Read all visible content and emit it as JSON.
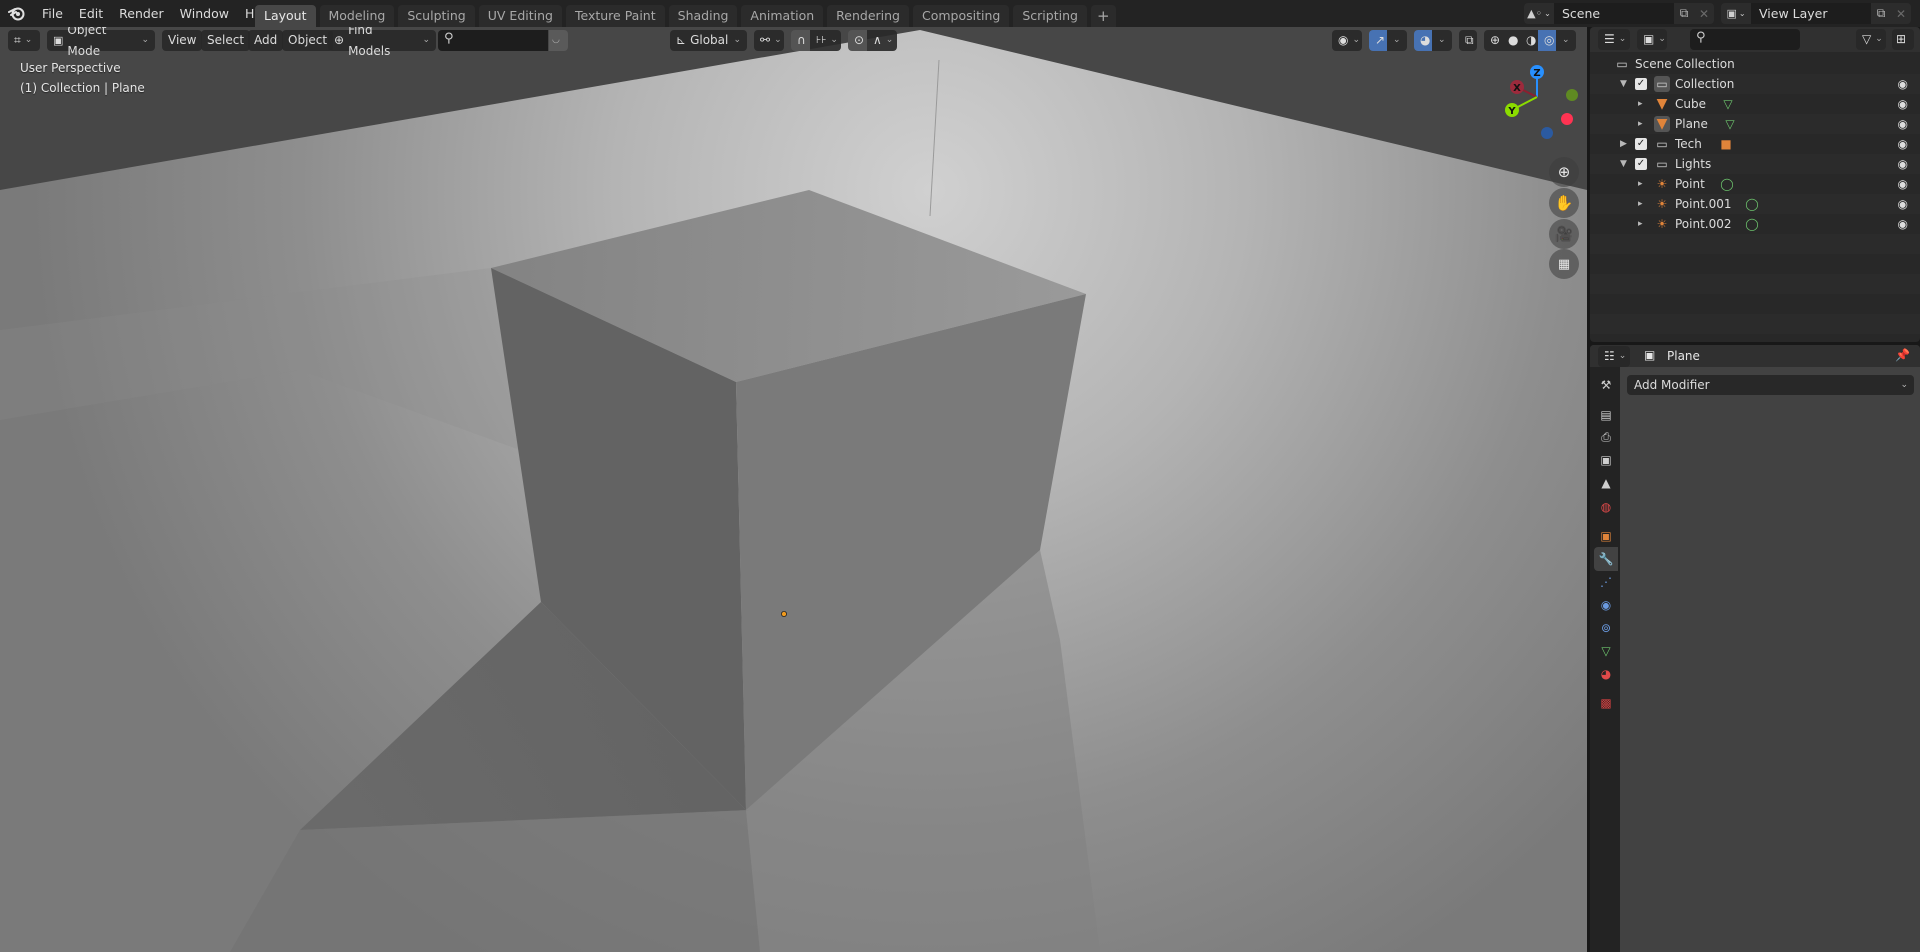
{
  "topbar": {
    "menus": [
      "File",
      "Edit",
      "Render",
      "Window",
      "Help"
    ],
    "workspaces": [
      "Layout",
      "Modeling",
      "Sculpting",
      "UV Editing",
      "Texture Paint",
      "Shading",
      "Animation",
      "Rendering",
      "Compositing",
      "Scripting"
    ],
    "active_workspace": "Layout",
    "add_workspace": "+",
    "scene": "Scene",
    "view_layer": "View Layer"
  },
  "viewport": {
    "header": {
      "mode": "Object Mode",
      "menus": [
        "View",
        "Select",
        "Add",
        "Object"
      ],
      "find_models": "Find Models",
      "search_placeholder": "",
      "transform_orientation": "Global"
    },
    "info": {
      "perspective": "User Perspective",
      "collection": "(1) Collection | Plane"
    },
    "gizmo": {
      "x": "X",
      "y": "Y",
      "z": "Z"
    },
    "colors": {
      "x_axis": "#ff3352",
      "y_axis": "#8bdc00",
      "z_axis": "#2890ff",
      "origin": "#f09a1e",
      "active_blue": "#4772b3"
    }
  },
  "outliner": {
    "search_placeholder": "",
    "root": "Scene Collection",
    "rows": [
      {
        "label": "Collection",
        "type": "collection",
        "depth": 0,
        "expanded": true,
        "checked": true,
        "active": true
      },
      {
        "label": "Cube",
        "type": "mesh-object",
        "depth": 1,
        "data_icon": "mesh-data"
      },
      {
        "label": "Plane",
        "type": "mesh-object",
        "depth": 1,
        "data_icon": "mesh-data",
        "active": true
      },
      {
        "label": "Tech",
        "type": "collection",
        "depth": 0,
        "expanded": false,
        "checked": true,
        "data_icon": "camera"
      },
      {
        "label": "Lights",
        "type": "collection",
        "depth": 0,
        "expanded": true,
        "checked": true
      },
      {
        "label": "Point",
        "type": "light-object",
        "depth": 1,
        "data_icon": "light-data"
      },
      {
        "label": "Point.001",
        "type": "light-object",
        "depth": 1,
        "data_icon": "light-data"
      },
      {
        "label": "Point.002",
        "type": "light-object",
        "depth": 1,
        "data_icon": "light-data"
      }
    ]
  },
  "properties": {
    "object_name": "Plane",
    "add_modifier": "Add Modifier",
    "active_tab": "modifiers",
    "tabs": [
      "tool",
      "render",
      "output",
      "view-layer",
      "scene",
      "world",
      "object",
      "modifiers",
      "particles",
      "physics",
      "constraints",
      "data",
      "material",
      "texture"
    ]
  }
}
